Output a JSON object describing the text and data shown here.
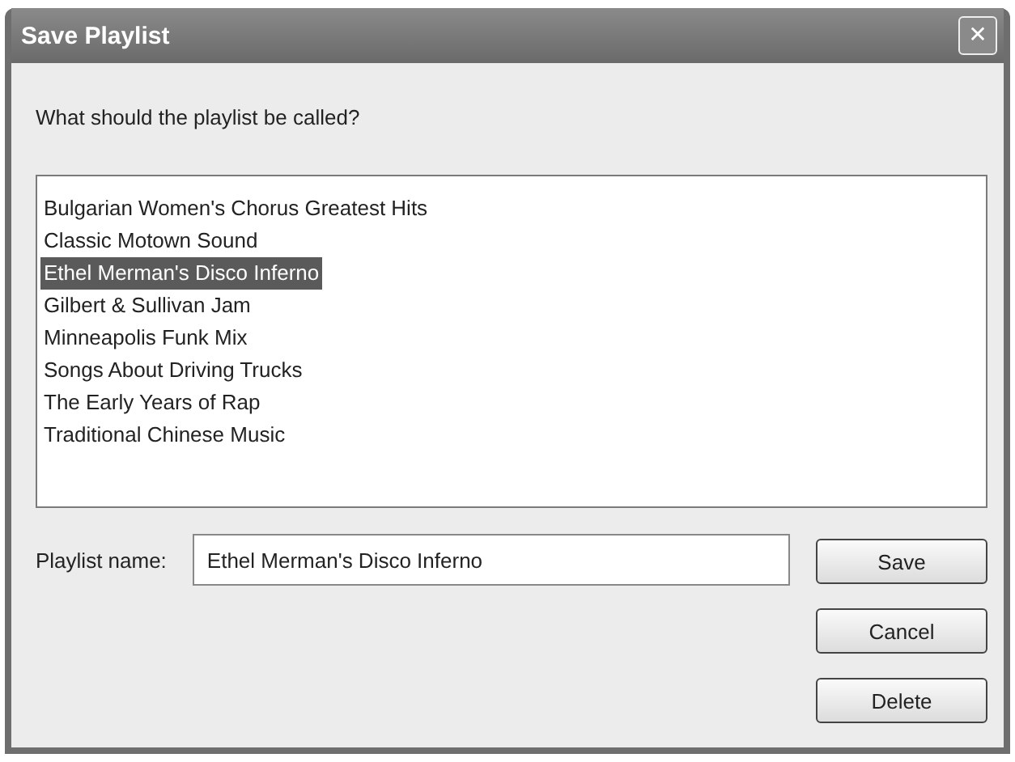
{
  "window": {
    "title": "Save Playlist",
    "close": "✕"
  },
  "prompt": "What should the playlist be called?",
  "playlists": [
    {
      "label": "Bulgarian Women's Chorus Greatest Hits",
      "selected": false
    },
    {
      "label": "Classic Motown Sound",
      "selected": false
    },
    {
      "label": "Ethel Merman's Disco Inferno",
      "selected": true
    },
    {
      "label": "Gilbert & Sullivan Jam",
      "selected": false
    },
    {
      "label": "Minneapolis Funk Mix",
      "selected": false
    },
    {
      "label": "Songs About Driving Trucks",
      "selected": false
    },
    {
      "label": "The Early Years of Rap",
      "selected": false
    },
    {
      "label": "Traditional Chinese Music",
      "selected": false
    }
  ],
  "name_field": {
    "label": "Playlist name:",
    "value": "Ethel Merman's Disco Inferno"
  },
  "buttons": [
    "Save",
    "Cancel",
    "Delete"
  ]
}
